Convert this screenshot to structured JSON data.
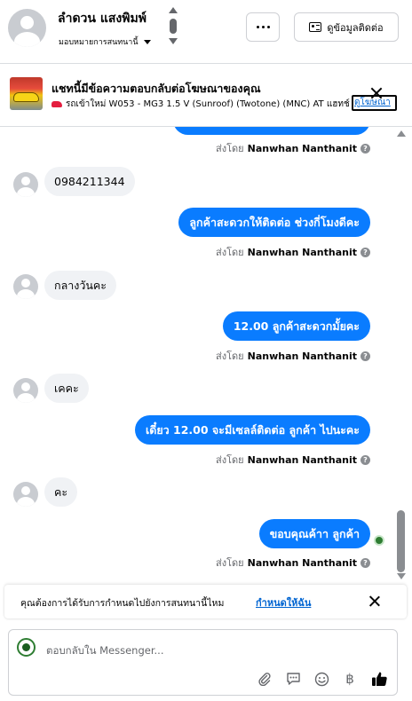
{
  "header": {
    "contact_name": "ลำดวน แสงพิมพ์",
    "assign_label": "มอบหมายการสนทนานี้",
    "more_label": "···",
    "details_label": "ดูข้อมูลติดต่อ"
  },
  "ad": {
    "title": "แชทนี้มีข้อความตอบกลับต่อโฆษณาของคุณ",
    "subtitle": "รถเข้าใหม่ W053 - MG3 1.5 V (Sunroof) (Twotone) (MNC) AT แฮทช์...",
    "link": "ดูโฆษณา"
  },
  "messages": [
    {
      "direction": "in",
      "text": "0984211344"
    },
    {
      "direction": "out",
      "text": "ลูกค้าสะดวกให้ติดต่อ ช่วงกี่โมงดีคะ",
      "sent_prefix": "ส่งโดย",
      "sender": "Nanwhan Nanthanit"
    },
    {
      "direction": "in",
      "text": "กลางวันคะ"
    },
    {
      "direction": "out",
      "text": "12.00 ลูกค้าสะดวกมั้ยคะ",
      "sent_prefix": "ส่งโดย",
      "sender": "Nanwhan Nanthanit"
    },
    {
      "direction": "in",
      "text": "เคคะ"
    },
    {
      "direction": "out",
      "text": "เดี๋ยว 12.00 จะมีเซลล์ติดต่อ ลูกค้า ไปนะคะ",
      "sent_prefix": "ส่งโดย",
      "sender": "Nanwhan Nanthanit"
    },
    {
      "direction": "in",
      "text": "คะ"
    },
    {
      "direction": "out",
      "text": "ขอบคุณค้าา ลูกค้า",
      "sent_prefix": "ส่งโดย",
      "sender": "Nanwhan Nanthanit"
    }
  ],
  "top_sent_by": {
    "sent_prefix": "ส่งโดย",
    "sender": "Nanwhan Nanthanit"
  },
  "prompt": {
    "text": "คุณต้องการได้รับการกำหนดไปยังการสนทนานี้ไหม",
    "link": "กำหนดให้ฉัน"
  },
  "composer": {
    "placeholder": "ตอบกลับใน Messenger...",
    "currency_symbol": "฿"
  },
  "colors": {
    "outgoing_bubble": "#0a7cff",
    "incoming_bubble": "#f0f2f5",
    "link": "#0064d1"
  },
  "icons": [
    "more-icon",
    "contact-card-icon",
    "close-icon",
    "info-icon",
    "attach-icon",
    "saved-reply-icon",
    "emoji-icon",
    "currency-icon",
    "like-icon"
  ]
}
